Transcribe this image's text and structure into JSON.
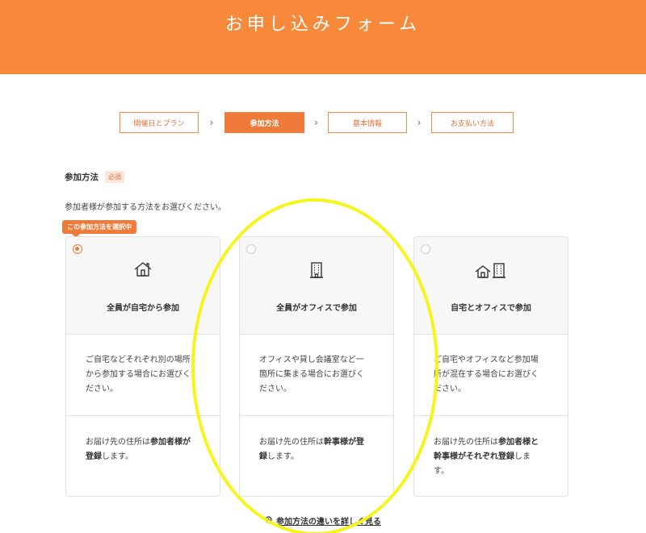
{
  "brand_color": "#f8893a",
  "highlight_color": "#f5f51d",
  "header": {
    "title": "お申し込みフォーム"
  },
  "steps": [
    {
      "label": "開催日とプラン",
      "active": false
    },
    {
      "label": "参加方法",
      "active": true
    },
    {
      "label": "基本情報",
      "active": false
    },
    {
      "label": "お支払い方法",
      "active": false
    }
  ],
  "step_separator": "›",
  "section": {
    "title": "参加方法",
    "required_label": "必須",
    "description": "参加者様が参加する方法をお選びください。"
  },
  "selected_badge": "この参加方法を選択中",
  "cards": [
    {
      "icon": "house-icon",
      "title": "全員が自宅から参加",
      "text1_lines": [
        "ご自宅などそれぞれ別の場所",
        "から参加する場合にお選びく",
        "ださい。"
      ],
      "text2_pre": "お届け先の住所は",
      "text2_bold1": "参加者様が",
      "text2_bold2": "登録",
      "text2_post": "します。",
      "selected": true
    },
    {
      "icon": "office-building-icon",
      "title": "全員がオフィスで参加",
      "text1_lines": [
        "オフィスや貸し会議室など一",
        "箇所に集まる場合にお選びく",
        "ださい。"
      ],
      "text2_pre": "お届け先の住所は",
      "text2_bold1": "幹事様が登",
      "text2_bold2": "録",
      "text2_post": "します。",
      "selected": false
    },
    {
      "icon": "house-and-building-icon",
      "title": "自宅とオフィスで参加",
      "text1_lines": [
        "ご自宅やオフィスなど参加場",
        "所が混在する場合にお選びく",
        "ださい。"
      ],
      "text2_pre": "お届け先の住所は",
      "text2_bold1": "参加者様と",
      "text2_bold2": "幹事様がそれぞれ登録",
      "text2_post": "しま",
      "text2_post2": "す。",
      "selected": false
    }
  ],
  "detail_link": "参加方法の違いを詳しく見る"
}
